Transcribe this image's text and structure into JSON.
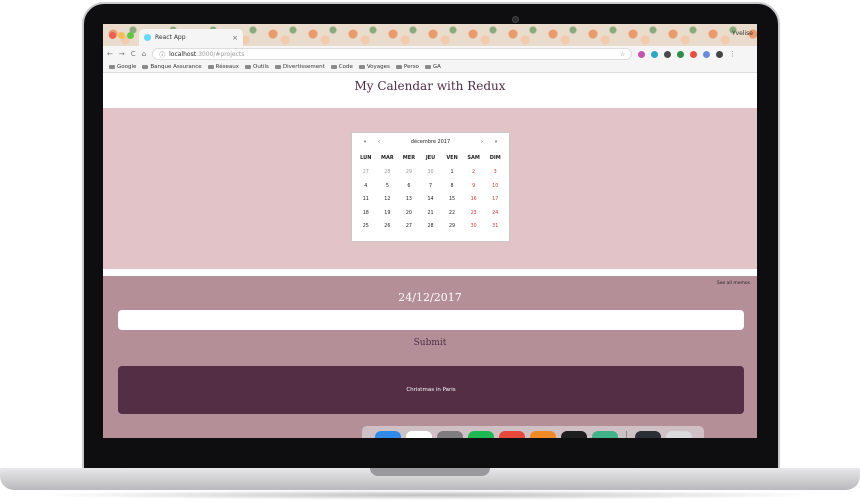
{
  "browser": {
    "tab_title": "React App",
    "tab_close": "×",
    "user": "Yvelise",
    "nav": {
      "back": "←",
      "forward": "→",
      "reload": "C",
      "home": "⌂"
    },
    "url_host": "localhost",
    "url_path": ":3000/#projects",
    "bookmarks": [
      "Google",
      "Banque Assurance",
      "Réseaux",
      "Outils",
      "Divertissement",
      "Code",
      "Voyages",
      "Perso",
      "GA"
    ]
  },
  "app": {
    "title": "My Calendar with Redux",
    "calendar": {
      "month_label": "décembre 2017",
      "prev_year": "«",
      "prev_month": "‹",
      "next_month": "›",
      "next_year": "»",
      "weekdays": [
        "LUN",
        "MAR",
        "MER",
        "JEU",
        "VEN",
        "SAM",
        "DIM"
      ],
      "days": [
        {
          "label": "27",
          "other": true,
          "weekend": false
        },
        {
          "label": "28",
          "other": true,
          "weekend": false
        },
        {
          "label": "29",
          "other": true,
          "weekend": false
        },
        {
          "label": "30",
          "other": true,
          "weekend": false
        },
        {
          "label": "1",
          "other": false,
          "weekend": false
        },
        {
          "label": "2",
          "other": false,
          "weekend": true
        },
        {
          "label": "3",
          "other": false,
          "weekend": true
        },
        {
          "label": "4",
          "other": false,
          "weekend": false
        },
        {
          "label": "5",
          "other": false,
          "weekend": false
        },
        {
          "label": "6",
          "other": false,
          "weekend": false
        },
        {
          "label": "7",
          "other": false,
          "weekend": false
        },
        {
          "label": "8",
          "other": false,
          "weekend": false
        },
        {
          "label": "9",
          "other": false,
          "weekend": true
        },
        {
          "label": "10",
          "other": false,
          "weekend": true
        },
        {
          "label": "11",
          "other": false,
          "weekend": false
        },
        {
          "label": "12",
          "other": false,
          "weekend": false
        },
        {
          "label": "13",
          "other": false,
          "weekend": false
        },
        {
          "label": "14",
          "other": false,
          "weekend": false
        },
        {
          "label": "15",
          "other": false,
          "weekend": false
        },
        {
          "label": "16",
          "other": false,
          "weekend": true
        },
        {
          "label": "17",
          "other": false,
          "weekend": true
        },
        {
          "label": "18",
          "other": false,
          "weekend": false
        },
        {
          "label": "19",
          "other": false,
          "weekend": false
        },
        {
          "label": "20",
          "other": false,
          "weekend": false
        },
        {
          "label": "21",
          "other": false,
          "weekend": false
        },
        {
          "label": "22",
          "other": false,
          "weekend": false
        },
        {
          "label": "23",
          "other": false,
          "weekend": true
        },
        {
          "label": "24",
          "other": false,
          "weekend": true
        },
        {
          "label": "25",
          "other": false,
          "weekend": false
        },
        {
          "label": "26",
          "other": false,
          "weekend": false
        },
        {
          "label": "27",
          "other": false,
          "weekend": false
        },
        {
          "label": "28",
          "other": false,
          "weekend": false
        },
        {
          "label": "29",
          "other": false,
          "weekend": false
        },
        {
          "label": "30",
          "other": false,
          "weekend": true
        },
        {
          "label": "31",
          "other": false,
          "weekend": true
        }
      ]
    },
    "see_all": "See all memos",
    "selected_date": "24/12/2017",
    "memo_input_value": "",
    "submit_label": "Submit",
    "memos": [
      "Christmas in Paris"
    ]
  },
  "dock": {
    "apps": [
      {
        "name": "finder-icon",
        "glyph": "☺",
        "color": "#2f8ae8",
        "running": true
      },
      {
        "name": "calendar-icon",
        "glyph": "15",
        "color": "#ffffff",
        "running": false
      },
      {
        "name": "system-preferences-icon",
        "glyph": "⚙",
        "color": "#7d7d80",
        "running": false
      },
      {
        "name": "spotify-icon",
        "glyph": "≋",
        "color": "#1db954",
        "running": true
      },
      {
        "name": "chrome-icon",
        "glyph": "◉",
        "color": "#e8483a",
        "running": true
      },
      {
        "name": "sublime-text-icon",
        "glyph": "S",
        "color": "#f08a24",
        "running": true
      },
      {
        "name": "terminal-icon",
        "glyph": "$_",
        "color": "#1e1e1e",
        "running": true
      },
      {
        "name": "atom-icon",
        "glyph": "⚛",
        "color": "#41b38a",
        "running": false
      }
    ],
    "right": [
      {
        "name": "minimized-window-icon",
        "glyph": "▤",
        "color": "#2a2f36"
      },
      {
        "name": "trash-icon",
        "glyph": "▯",
        "color": "#d9dadc"
      }
    ]
  }
}
